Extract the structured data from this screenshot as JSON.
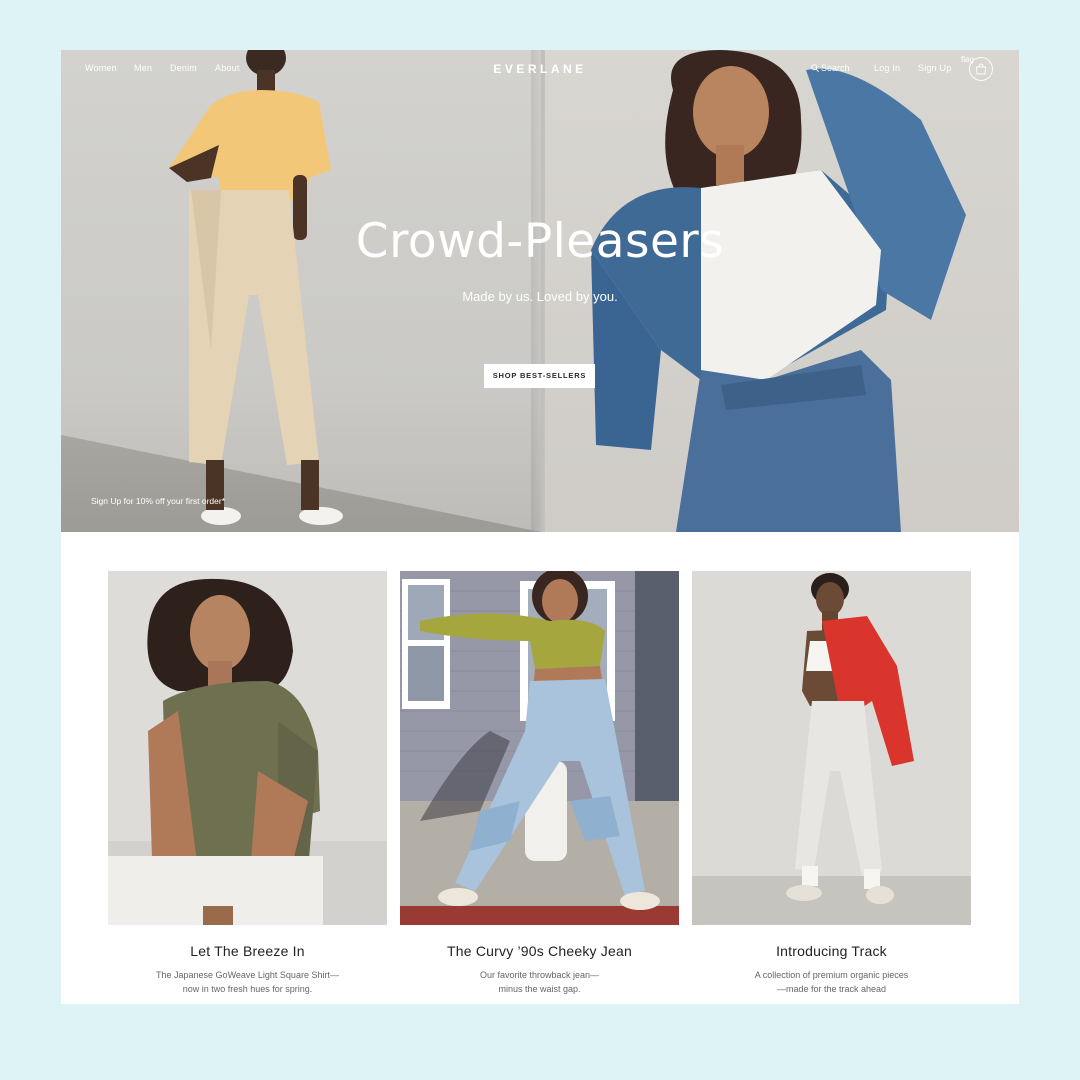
{
  "nav": {
    "left_links": [
      "Women",
      "Men",
      "Denim",
      "About"
    ],
    "brand": "EVERLANE",
    "search_label": "Search",
    "login_label": "Log In",
    "signup_label": "Sign Up",
    "flag_label": "flag",
    "cart_icon": "bag-icon",
    "search_icon": "search-icon"
  },
  "hero": {
    "title": "Crowd-Pleasers",
    "subtitle": "Made by us. Loved by you.",
    "cta": "SHOP BEST-SELLERS",
    "promo": "Sign Up for 10% off your first order*"
  },
  "cards": [
    {
      "title": "Let The Breeze In",
      "desc_line1": "The Japanese GoWeave Light Square Shirt—",
      "desc_line2": "now in two fresh hues for spring."
    },
    {
      "title": "The Curvy ’90s Cheeky Jean",
      "desc_line1": "Our favorite throwback jean—",
      "desc_line2": "minus the waist gap."
    },
    {
      "title": "Introducing Track",
      "desc_line1": "A collection of premium organic pieces",
      "desc_line2": "—made for the track ahead"
    }
  ],
  "colors": {
    "frame_bg": "#def3f6",
    "page_bg": "#ffffff",
    "text_dark": "#222222",
    "text_muted": "#666666"
  }
}
